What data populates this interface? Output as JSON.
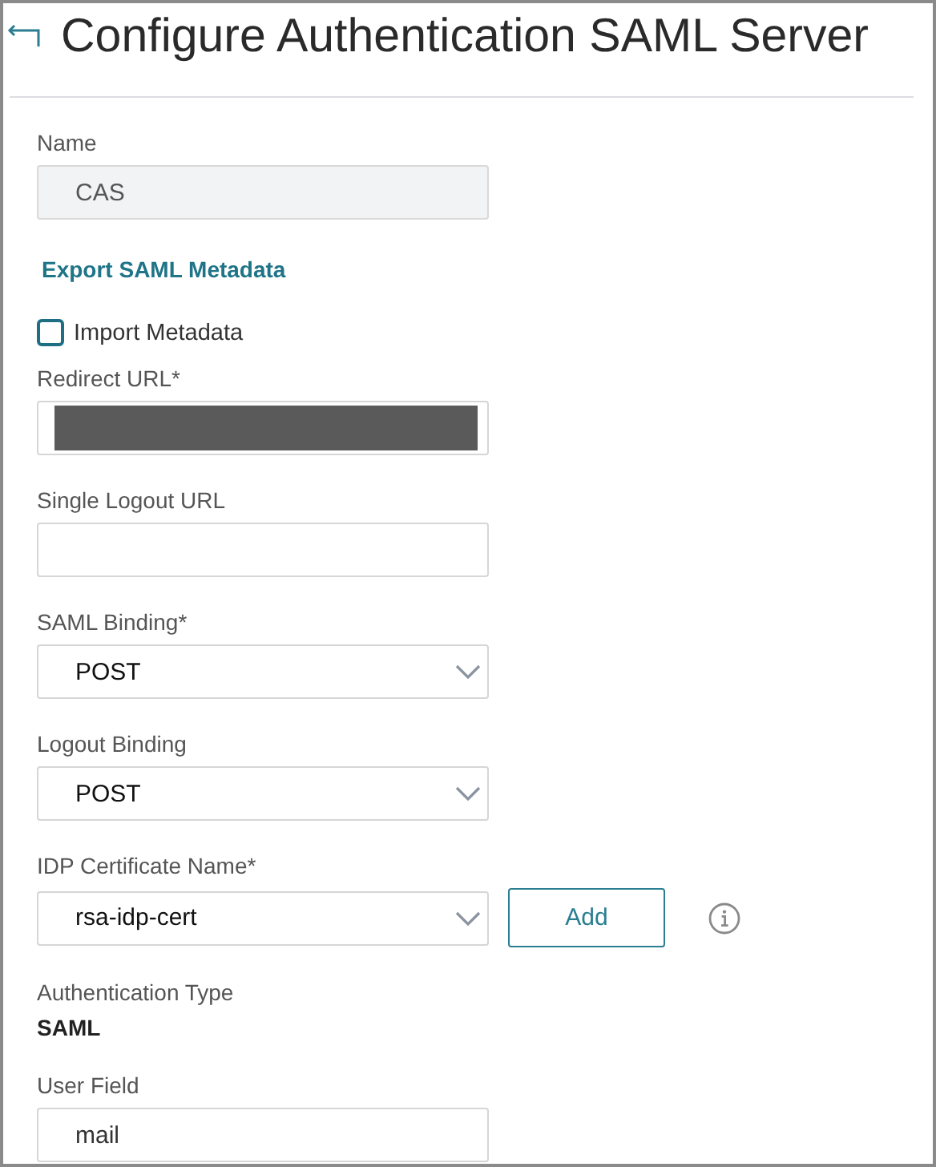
{
  "header": {
    "title": "Configure Authentication SAML Server"
  },
  "items": [
    {
      "kind": "text",
      "label": "Name",
      "value": "CAS",
      "disabled": true
    },
    {
      "kind": "link",
      "label": "Export SAML Metadata"
    },
    {
      "kind": "checkbox",
      "label": "Import Metadata",
      "checked": false
    },
    {
      "kind": "text",
      "label": "Redirect URL*",
      "value": "",
      "redacted": true
    },
    {
      "kind": "text",
      "label": "Single Logout URL",
      "value": ""
    },
    {
      "kind": "select",
      "label": "SAML Binding*",
      "value": "POST"
    },
    {
      "kind": "select",
      "label": "Logout Binding",
      "value": "POST"
    },
    {
      "kind": "select",
      "label": "IDP Certificate Name*",
      "value": "rsa-idp-cert",
      "button": "Add",
      "info": true
    },
    {
      "kind": "static",
      "label": "Authentication Type",
      "value": "SAML"
    },
    {
      "kind": "text",
      "label": "User Field",
      "value": "mail"
    }
  ]
}
